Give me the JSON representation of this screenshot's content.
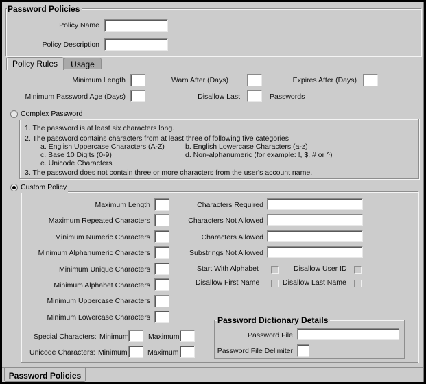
{
  "header": {
    "title": "Password Policies",
    "policy_name_label": "Policy Name",
    "policy_name_value": "",
    "policy_description_label": "Policy Description",
    "policy_description_value": ""
  },
  "tabs": [
    {
      "label": "Policy Rules",
      "active": true
    },
    {
      "label": "Usage",
      "active": false
    }
  ],
  "rules": {
    "minimum_length_label": "Minimum Length",
    "minimum_length_value": "",
    "warn_after_label": "Warn After (Days)",
    "warn_after_value": "",
    "expires_after_label": "Expires After (Days)",
    "expires_after_value": "",
    "min_password_age_label": "Minimum Password Age (Days)",
    "min_password_age_value": "",
    "disallow_last_label": "Disallow Last",
    "disallow_last_value": "",
    "passwords_suffix": "Passwords"
  },
  "complex_password": {
    "label": "Complex Password",
    "selected": false,
    "lines": [
      "1. The password is at least six characters long.",
      "2. The password contains characters from at least three of following five categories",
      "a. English Uppercase Characters (A-Z)",
      "b. English Lowercase Characters (a-z)",
      "c. Base 10 Digits (0-9)",
      "d. Non-alphanumeric (for example: !, $, # or ^)",
      "e. Unicode Characters",
      "3. The password does not contain three or more characters from the user's account name."
    ]
  },
  "custom_policy": {
    "label": "Custom Policy",
    "selected": true,
    "left_fields": [
      {
        "label": "Maximum Length",
        "value": ""
      },
      {
        "label": "Maximum Repeated Characters",
        "value": ""
      },
      {
        "label": "Minimum Numeric Characters",
        "value": ""
      },
      {
        "label": "Minimum Alphanumeric Characters",
        "value": ""
      },
      {
        "label": "Minimum Unique Characters",
        "value": ""
      },
      {
        "label": "Minimum Alphabet Characters",
        "value": ""
      },
      {
        "label": "Minimum Uppercase Characters",
        "value": ""
      },
      {
        "label": "Minimum Lowercase Characters",
        "value": ""
      }
    ],
    "right_fields": [
      {
        "label": "Characters Required",
        "value": ""
      },
      {
        "label": "Characters Not Allowed",
        "value": ""
      },
      {
        "label": "Characters Allowed",
        "value": ""
      },
      {
        "label": "Substrings Not Allowed",
        "value": ""
      }
    ],
    "checkboxes": [
      {
        "label": "Start With Alphabet",
        "checked": false
      },
      {
        "label": "Disallow User ID",
        "checked": false
      },
      {
        "label": "Disallow First Name",
        "checked": false
      },
      {
        "label": "Disallow Last Name",
        "checked": false
      }
    ],
    "special_label": "Special Characters:",
    "unicode_label": "Unicode Characters:",
    "minimum_label": "Minimum",
    "maximum_label": "Maximum",
    "special_min": "",
    "special_max": "",
    "unicode_min": "",
    "unicode_max": ""
  },
  "dictionary": {
    "title": "Password Dictionary Details",
    "file_label": "Password File",
    "file_value": "",
    "delimiter_label": "Password File Delimiter",
    "delimiter_value": ""
  },
  "bottom_tab": {
    "label": "Password Policies"
  }
}
